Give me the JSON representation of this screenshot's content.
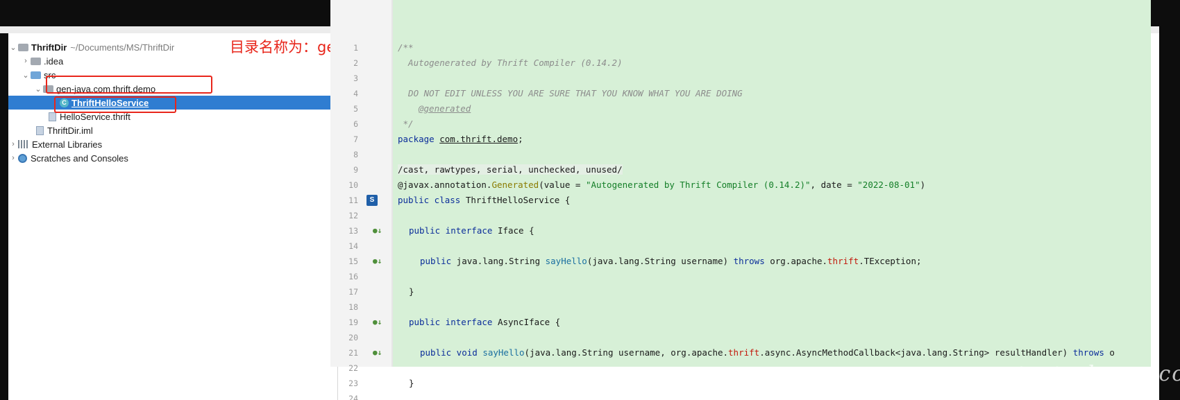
{
  "project_tree": {
    "root_name": "ThriftDir",
    "root_path": "~/Documents/MS/ThriftDir",
    "items": [
      {
        "label": ".idea"
      },
      {
        "label": "src"
      },
      {
        "label": "gen-java.com.thrift.demo"
      },
      {
        "label": "ThriftHelloService"
      },
      {
        "label": "HelloService.thrift"
      },
      {
        "label": "ThriftDir.iml"
      },
      {
        "label": "External Libraries"
      },
      {
        "label": "Scratches and Consoles"
      }
    ]
  },
  "annotation": {
    "text": "目录名称为：get-java.包名（在脚本中创建的namespace）",
    "color": "#e8261b"
  },
  "editor": {
    "background": "#d7f0d7",
    "line_numbers": [
      "1",
      "2",
      "3",
      "4",
      "5",
      "6",
      "7",
      "8",
      "9",
      "10",
      "11",
      "12",
      "13",
      "14",
      "15",
      "16",
      "17",
      "18",
      "19",
      "20",
      "21",
      "22",
      "23",
      "24"
    ],
    "lines": {
      "l1": "/**",
      "l2": "  Autogenerated by Thrift Compiler (0.14.2)",
      "l4": "  DO NOT EDIT UNLESS YOU ARE SURE THAT YOU KNOW WHAT YOU ARE DOING",
      "l5": "@generated",
      "l6": " */",
      "l7_kw": "package",
      "l7_pkg": "com.thrift.demo",
      "l7_end": ";",
      "l9": "/cast, rawtypes, serial, unchecked, unused/",
      "l10_at": "@javax.annotation.",
      "l10_gen": "Generated",
      "l10_a": "(value = ",
      "l10_s1": "\"Autogenerated by Thrift Compiler (0.14.2)\"",
      "l10_b": ", date = ",
      "l10_s2": "\"2022-08-01\"",
      "l10_c": ")",
      "l11_kw": "public class",
      "l11_rest": " ThriftHelloService {",
      "l13_kw": "public interface",
      "l13_rest": " Iface {",
      "l15_kw": "public",
      "l15_a": " java.lang.String ",
      "l15_m": "sayHello",
      "l15_b": "(java.lang.String username) ",
      "l15_kw2": "throws",
      "l15_c": " org.apache.",
      "l15_red": "thrift",
      "l15_d": ".TException;",
      "l17": "}",
      "l19_kw": "public interface",
      "l19_rest": " AsyncIface {",
      "l21_kw": "public void",
      "l21_m": " sayHello",
      "l21_a": "(java.lang.String username, org.apache.",
      "l21_red": "thrift",
      "l21_b": ".async.AsyncMethodCallback<java.lang.String> resultHandler) ",
      "l21_kw2": "throws",
      "l21_c": " o",
      "l23": "}"
    },
    "class_badge": "S"
  },
  "watermark": "testerhome.com"
}
